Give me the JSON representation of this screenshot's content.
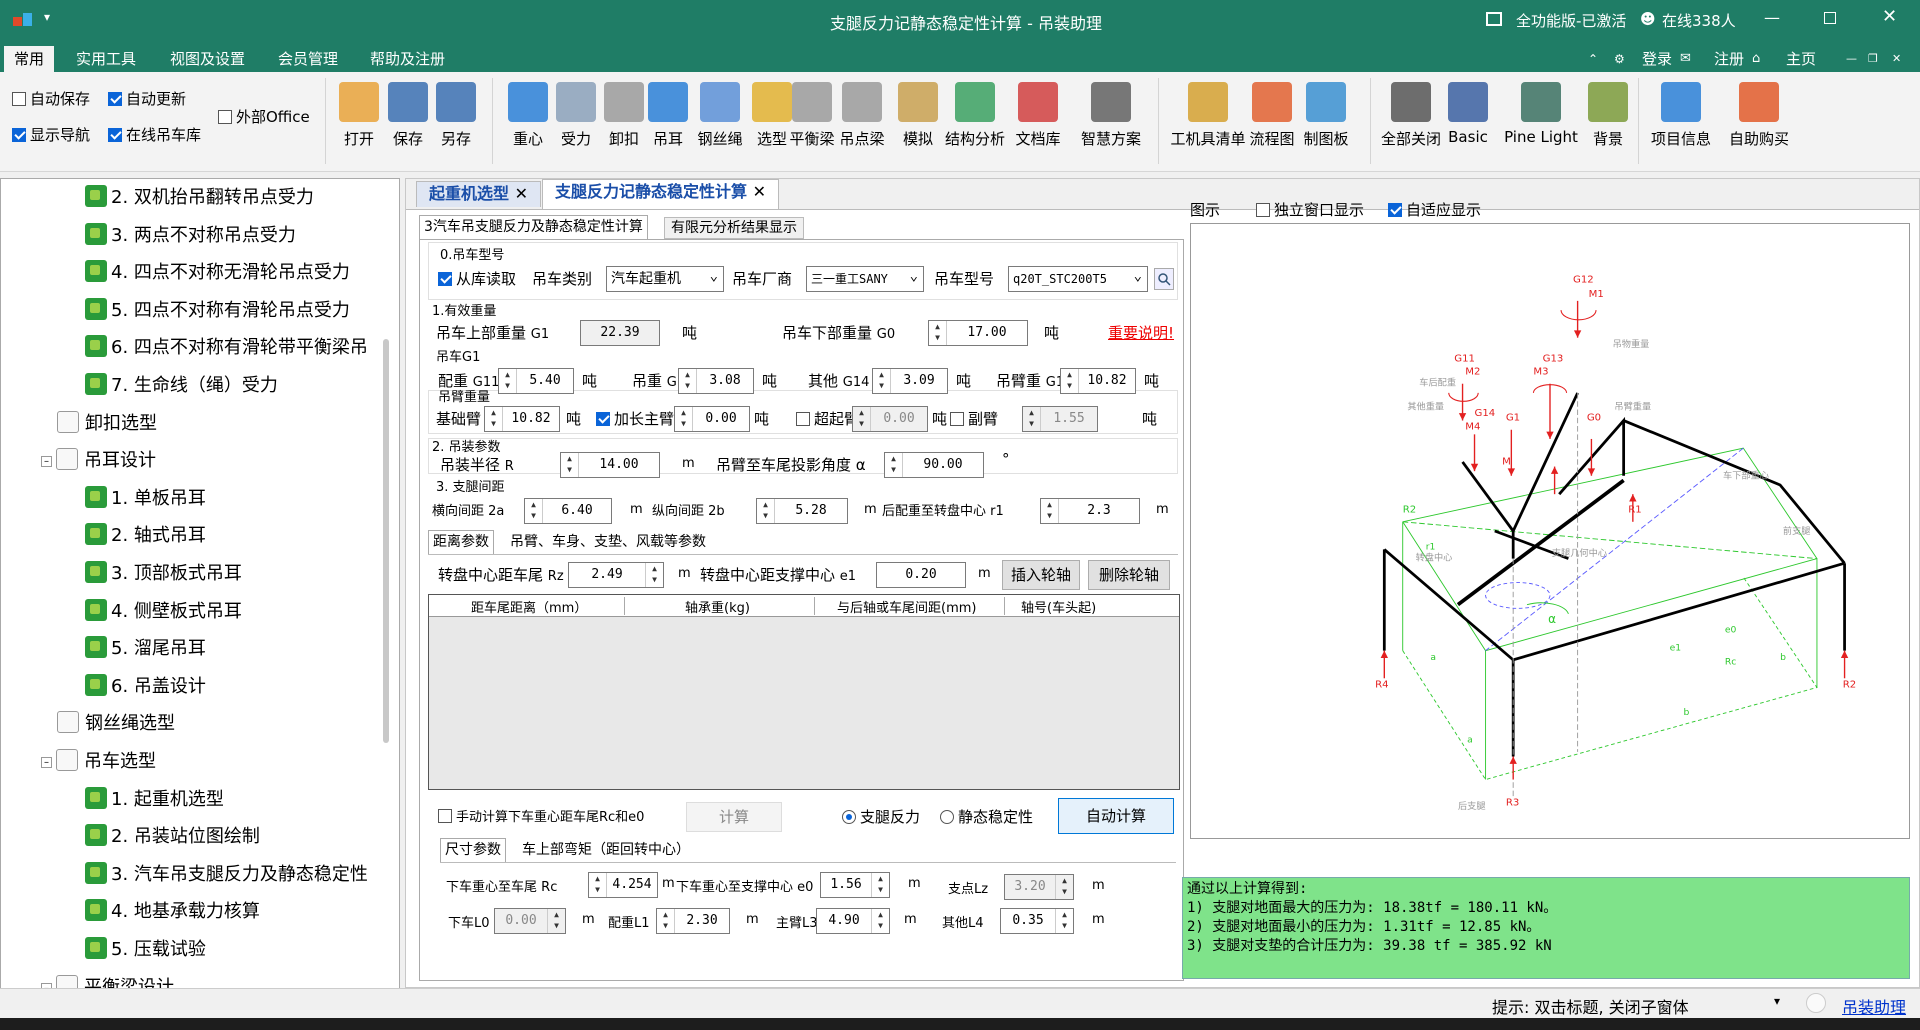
{
  "titlebar": {
    "title": "支腿反力记静态稳定性计算",
    "app": "吊装助理",
    "license": "全功能版-已激活",
    "online": "在线338人"
  },
  "menu": {
    "items": [
      "常用",
      "实用工具",
      "视图及设置",
      "会员管理",
      "帮助及注册"
    ],
    "right": [
      "登录",
      "注册",
      "主页"
    ]
  },
  "ribbon": {
    "options": {
      "autosave": "自动保存",
      "autoupdate": "自动更新",
      "external_office": "外部Office",
      "show_nav": "显示导航",
      "online_crane": "在线吊车库"
    },
    "file": [
      "打开",
      "保存",
      "另存"
    ],
    "calc": [
      "重心",
      "受力",
      "卸扣",
      "吊耳",
      "钢丝绳",
      "选型",
      "平衡梁",
      "吊点梁",
      "模拟",
      "结构分析",
      "文档库",
      "智慧方案"
    ],
    "tools": [
      "工机具清单",
      "流程图",
      "制图板"
    ],
    "view": [
      "全部关闭",
      "Basic",
      "Pine Light",
      "背景"
    ],
    "info": [
      "项目信息",
      "自助购买"
    ]
  },
  "tree": {
    "items": [
      "2. 双机抬吊翻转吊点受力",
      "3. 两点不对称吊点受力",
      "4. 四点不对称无滑轮吊点受力",
      "5. 四点不对称有滑轮吊点受力",
      "6. 四点不对称有滑轮带平衡梁吊",
      "7. 生命线（绳）受力",
      "卸扣选型",
      "吊耳设计",
      "1. 单板吊耳",
      "2. 轴式吊耳",
      "3. 顶部板式吊耳",
      "4. 侧壁板式吊耳",
      "5. 溜尾吊耳",
      "6. 吊盖设计",
      "钢丝绳选型",
      "吊车选型",
      "1. 起重机选型",
      "2. 吊装站位图绘制",
      "3. 汽车吊支腿反力及静态稳定性",
      "4. 地基承载力核算",
      "5. 压载试验",
      "平衡梁设计"
    ]
  },
  "tabs": {
    "doc1": "起重机选型",
    "doc2": "支腿反力记静态稳定性计算",
    "sub1": "3汽车吊支腿反力及静态稳定性计算",
    "sub2": "有限元分析结果显示"
  },
  "form": {
    "s0": "0.吊车型号",
    "from_lib": "从库读取",
    "crane_type_label": "吊车类别",
    "crane_type": "汽车起重机",
    "maker_label": "吊车厂商",
    "maker": "三一重工SANY",
    "model_label": "吊车型号",
    "model": "q20T_STC200T5",
    "s1": "1.有效重量",
    "upper_label": "吊车上部重量",
    "upper_sym": "G1",
    "upper": "22.39",
    "t": "吨",
    "lower_label": "吊车下部重量",
    "lower_sym": "G0",
    "lower": "17.00",
    "important": "重要说明!",
    "g1_title": "吊车G1",
    "cw_label": "配重",
    "cw_sym": "G11",
    "cw": "5.40",
    "hook_label": "吊重",
    "hook_sym": "G12",
    "hook": "3.08",
    "other_label": "其他",
    "other_sym": "G14",
    "other": "3.09",
    "arm_label": "吊臂重",
    "arm_sym": "G13",
    "arm": "10.82",
    "boom_title": "吊臂重量",
    "base_label": "基础臂",
    "base": "10.82",
    "ext_label": "加长主臂",
    "ext": "0.00",
    "super_label": "超起臂",
    "super": "0.00",
    "jib_label": "副臂",
    "jib": "1.55",
    "s2": "2. 吊装参数",
    "radius_label": "吊装半径",
    "radius_sym": "R",
    "radius": "14.00",
    "m": "m",
    "angle_label": "吊臂至车尾投影角度",
    "angle_sym": "α",
    "angle": "90.00",
    "deg": "°",
    "s3": "3. 支腿间距",
    "tspan_label": "横向间距",
    "tspan_sym": "2a",
    "tspan": "6.40",
    "lspan_label": "纵向间距",
    "lspan_sym": "2b",
    "lspan": "5.28",
    "rear_label": "后配重至转盘中心",
    "rear_sym": "r1",
    "rear": "2.3",
    "tab_dist": "距离参数",
    "tab_arm": "吊臂、车身、支垫、风载等参数",
    "rz_label": "转盘中心距车尾",
    "rz_sym": "Rz",
    "rz": "2.49",
    "e1_label": "转盘中心距支撑中心",
    "e1_sym": "e1",
    "e1": "0.20",
    "insert": "插入轮轴",
    "delete": "删除轮轴",
    "cols": [
      "距车尾距离（mm）",
      "轴承重(kg)",
      "与后轴或车尾间距(mm)",
      "轴号(车头起)"
    ],
    "manual": "手动计算下车重心距车尾Rc和e0",
    "calc": "计算",
    "r_force": "支腿反力",
    "r_stab": "静态稳定性",
    "auto": "自动计算",
    "tab_size": "尺寸参数",
    "tab_moment": "车上部弯矩（距回转中心）",
    "rc_label": "下车重心至车尾",
    "rc_sym": "Rc",
    "rc": "4.254",
    "e0_label": "下车重心至支撑中心",
    "e0_sym": "e0",
    "e0": "1.56",
    "lz_label": "支点Lz",
    "lz": "3.20",
    "l0_label": "下车L0",
    "l0": "0.00",
    "l1_label": "配重L1",
    "l1": "2.30",
    "l3_label": "主臂L3",
    "l3": "4.90",
    "l4_label": "其他L4",
    "l4": "0.35"
  },
  "diagram": {
    "label": "图示",
    "standalone": "独立窗口显示",
    "adaptive": "自适应显示",
    "labels": {
      "G12": "G12",
      "M1": "M1",
      "G11": "G11",
      "M2": "M2",
      "G13": "G13",
      "M3": "M3",
      "G14": "G14",
      "M4": "M4",
      "G1": "G1",
      "G0": "G0",
      "M": "M",
      "R1": "R1",
      "R2a": "R2",
      "R2b": "R2",
      "R3": "R3",
      "R4": "R4",
      "alpha": "α",
      "Rc": "Rc",
      "e0": "e0",
      "e1": "e1",
      "a": "a",
      "b": "b",
      "a2": "a",
      "b2": "b",
      "r1": "r1",
      "hook_wt": "吊物重量",
      "rear_cw": "车后配重",
      "other_wt": "其他重量",
      "arm_wt": "吊臂重量",
      "lower_cg": "车下部重心",
      "front_leg": "前支腿",
      "turn_center": "转盘中心",
      "leg_geo": "支腿几何中心",
      "rear_leg": "后支腿"
    }
  },
  "result": {
    "line0": "通过以上计算得到:",
    "line1": "1) 支腿对地面最大的压力为: 18.38tf = 180.11 kN。",
    "line2": "2) 支腿对地面最小的压力为: 1.31tf = 12.85 kN。",
    "line3": "3) 支腿对支垫的合计压力为: 39.38 tf = 385.92 kN"
  },
  "status": {
    "hint": "提示: 双击标题, 关闭子窗体",
    "brand": "吊装助理"
  }
}
